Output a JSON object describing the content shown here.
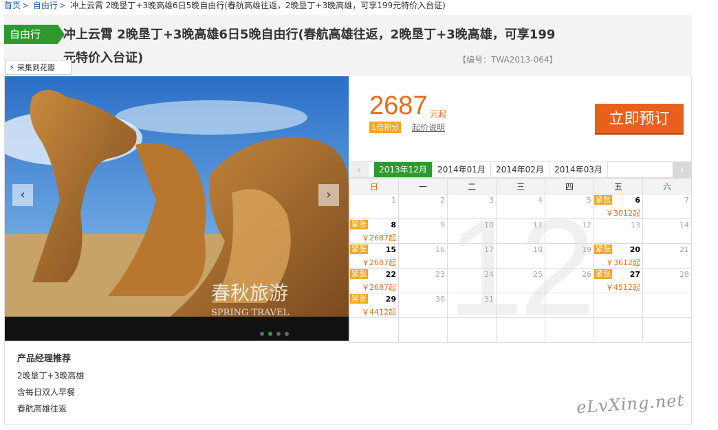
{
  "breadcrumb": {
    "home": "首页",
    "sep": ">",
    "category": "自由行",
    "current": "冲上云霄 2晚垦丁+3晚高雄6日5晚自由行(春航高雄往返，2晚垦丁+3晚高雄，可享199元特价入台证)"
  },
  "product": {
    "tag": "自由行",
    "title": "冲上云霄 2晚垦丁+3晚高雄6日5晚自由行(春航高雄往返，2晚垦丁+3晚高雄，可享199元特价入台证)",
    "code": "【编号：TWA2013-064】",
    "collect_label": "采集到花瓣"
  },
  "gallery": {
    "prev": "‹",
    "next": "›",
    "watermark_cn": "春秋旅游",
    "watermark_en": "SPRING TRAVEL",
    "slide_count": 4,
    "active_slide": 1
  },
  "pricing": {
    "price": "2687",
    "unit": "元起",
    "points": "1倍积分",
    "explain": "起价说明",
    "book_label": "立即预订"
  },
  "calendar": {
    "prev": "‹",
    "next": "›",
    "months": [
      "2013年12月",
      "2014年01月",
      "2014年02月",
      "2014年03月"
    ],
    "active_month": 0,
    "big_month": "12",
    "weekdays": [
      "日",
      "一",
      "二",
      "三",
      "四",
      "五",
      "六"
    ],
    "tight_label": "紧张",
    "weeks": [
      [
        {
          "d": "1"
        },
        {
          "d": "2"
        },
        {
          "d": "3"
        },
        {
          "d": "4"
        },
        {
          "d": "5"
        },
        {
          "d": "6",
          "price": "￥3012起",
          "tight": true
        },
        {
          "d": "7"
        }
      ],
      [
        {
          "d": "8",
          "price": "￥2687起",
          "tight": true
        },
        {
          "d": "9"
        },
        {
          "d": "10"
        },
        {
          "d": "11"
        },
        {
          "d": "12"
        },
        {
          "d": "13"
        },
        {
          "d": "14"
        }
      ],
      [
        {
          "d": "15",
          "price": "￥2687起",
          "tight": true
        },
        {
          "d": "16"
        },
        {
          "d": "17"
        },
        {
          "d": "18"
        },
        {
          "d": "19"
        },
        {
          "d": "20",
          "price": "￥3612起",
          "tight": true
        },
        {
          "d": "21"
        }
      ],
      [
        {
          "d": "22",
          "price": "￥2687起",
          "tight": true
        },
        {
          "d": "23"
        },
        {
          "d": "24"
        },
        {
          "d": "25"
        },
        {
          "d": "26"
        },
        {
          "d": "27",
          "price": "￥4512起",
          "tight": true
        },
        {
          "d": "28"
        }
      ],
      [
        {
          "d": "29",
          "price": "￥4412起",
          "tight": true
        },
        {
          "d": "30"
        },
        {
          "d": "31"
        },
        {
          "d": ""
        },
        {
          "d": ""
        },
        {
          "d": ""
        },
        {
          "d": ""
        }
      ],
      [
        {
          "d": ""
        },
        {
          "d": ""
        },
        {
          "d": ""
        },
        {
          "d": ""
        },
        {
          "d": ""
        },
        {
          "d": ""
        },
        {
          "d": ""
        }
      ]
    ]
  },
  "recommend": {
    "title": "产品经理推荐",
    "items": [
      "2晚垦丁+3晚高雄",
      "含每日双人早餐",
      "春航高雄往返"
    ]
  },
  "site_watermark": "eLvXing.net"
}
